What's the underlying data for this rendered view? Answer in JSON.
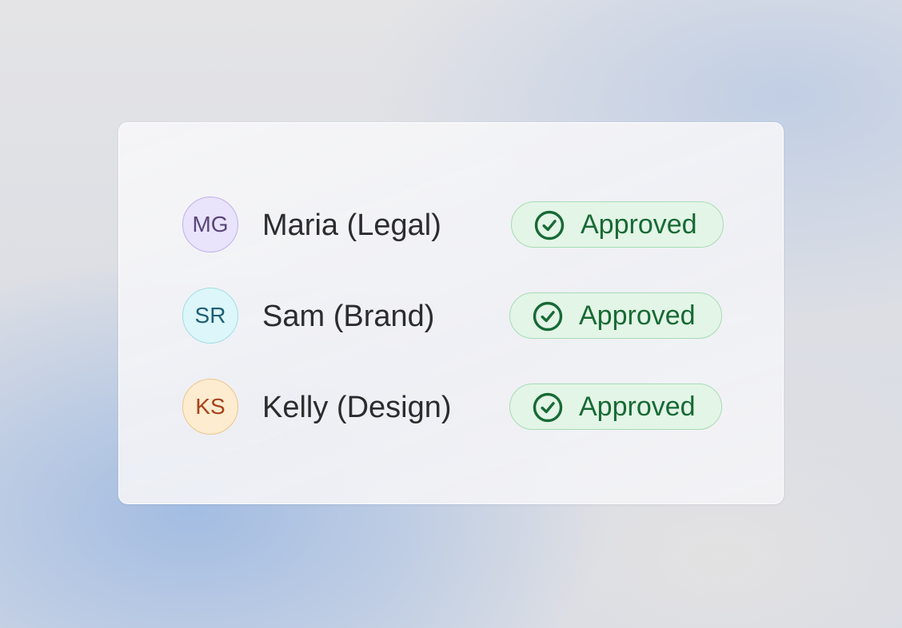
{
  "approvals": [
    {
      "initials": "MG",
      "name": "Maria (Legal)",
      "status": "Approved"
    },
    {
      "initials": "SR",
      "name": "Sam (Brand)",
      "status": "Approved"
    },
    {
      "initials": "KS",
      "name": "Kelly (Design)",
      "status": "Approved"
    }
  ],
  "colors": {
    "approved_text": "#176a34",
    "approved_bg": "#e3f5e7",
    "approved_border": "#a6dcb5",
    "avatar_mg": "#e9e3fb",
    "avatar_sr": "#ddf6f9",
    "avatar_ks": "#fdeccf"
  },
  "icons": {
    "status": "check-circle-icon"
  }
}
